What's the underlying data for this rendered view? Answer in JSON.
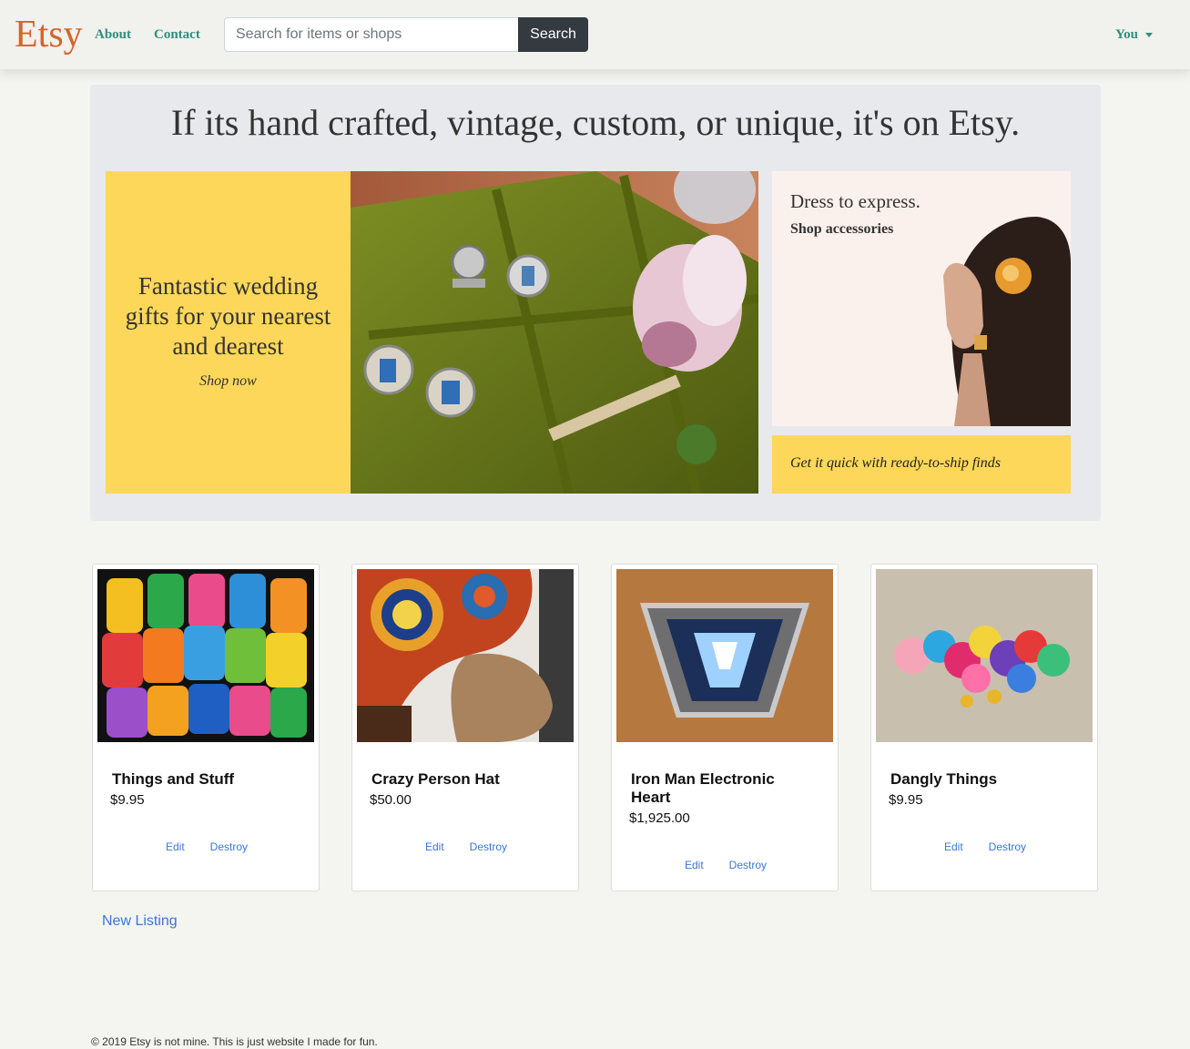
{
  "nav": {
    "brand": "Etsy",
    "about": "About",
    "contact": "Contact",
    "search_placeholder": "Search for items or shops",
    "search_button": "Search",
    "user_menu": "You"
  },
  "hero": {
    "title": "If its hand crafted, vintage, custom, or unique, it's on Etsy.",
    "promo_text": "Fantastic wedding gifts for your nearest and dearest",
    "promo_link": "Shop now",
    "side_title": "Dress to express.",
    "side_link": "Shop accessories",
    "banner_text": "Get it quick with ready-to-ship finds"
  },
  "listings": [
    {
      "title": "Things and Stuff",
      "price": "$9.95",
      "edit": "Edit",
      "destroy": "Destroy"
    },
    {
      "title": "Crazy Person Hat",
      "price": "$50.00",
      "edit": "Edit",
      "destroy": "Destroy"
    },
    {
      "title": "Iron Man Electronic Heart",
      "price": "$1,925.00",
      "edit": "Edit",
      "destroy": "Destroy"
    },
    {
      "title": "Dangly Things",
      "price": "$9.95",
      "edit": "Edit",
      "destroy": "Destroy"
    }
  ],
  "new_listing": "New Listing",
  "footer": "© 2019 Etsy is not mine. This is just website I made for fun.",
  "colors": {
    "brand": "#d5642a",
    "nav_link": "#2f8f7e",
    "promo_yellow": "#fdd75a",
    "link_blue": "#3a77d6"
  }
}
